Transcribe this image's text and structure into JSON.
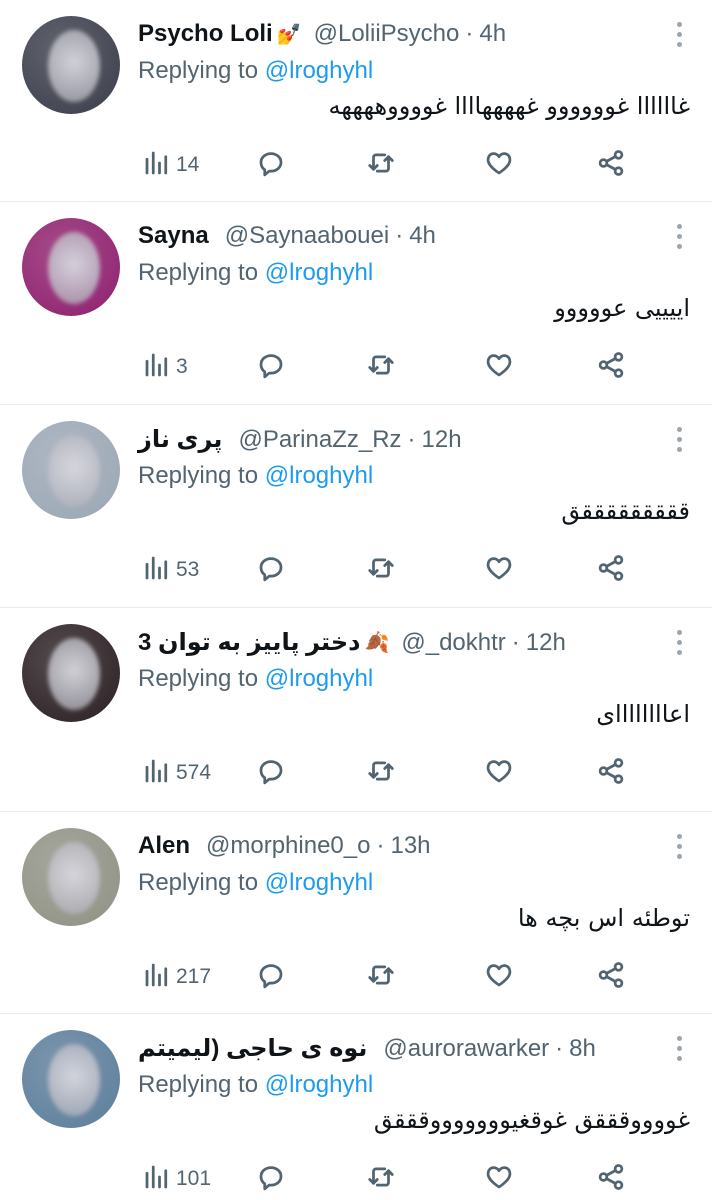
{
  "replying_label": "Replying to",
  "tweets": [
    {
      "name": "Psycho Loli",
      "emoji": "💅",
      "handle": "@LoliiPsycho",
      "time": "4h",
      "mention": "@lroghyhl",
      "text": "غاااااا غوووووو غههههاااا غووووههههه",
      "views": "14",
      "avatar_color": "#3a3d4a"
    },
    {
      "name": "Sayna",
      "emoji": "",
      "handle": "@Saynaabouei",
      "time": "4h",
      "mention": "@lroghyhl",
      "text": "اییییی عووووو",
      "views": "3",
      "avatar_color": "#8e1f6d"
    },
    {
      "name": "پری ناز",
      "emoji": "",
      "handle": "@ParinaZz_Rz",
      "time": "12h",
      "mention": "@lroghyhl",
      "text": "قققققققققق",
      "views": "53",
      "avatar_color": "#9aa6b4"
    },
    {
      "name": "دختر پاییز به توان 3",
      "emoji": "🍂",
      "handle": "@_dokhtr",
      "time": "12h",
      "mention": "@lroghyhl",
      "text": "اعاااااااای",
      "views": "574",
      "avatar_color": "#2a1f22"
    },
    {
      "name": "Alen",
      "emoji": "",
      "handle": "@morphine0_o",
      "time": "13h",
      "mention": "@lroghyhl",
      "text": "توطئه اس بچه ها",
      "views": "217",
      "avatar_color": "#8f9184"
    },
    {
      "name": "نوه ی حاجی (لیمیتم",
      "emoji": "",
      "handle": "@aurorawarker",
      "time": "8h",
      "mention": "@lroghyhl",
      "text": "غووووقققق غوقغیوووووووقققق",
      "views": "101",
      "avatar_color": "#5b7d9a"
    }
  ],
  "icons": {
    "views": "bar-chart-icon",
    "reply": "reply-bubble-icon",
    "retweet": "retweet-icon",
    "like": "heart-icon",
    "share": "share-icon",
    "more": "more-icon"
  },
  "accent_color": "#1d9bf0"
}
